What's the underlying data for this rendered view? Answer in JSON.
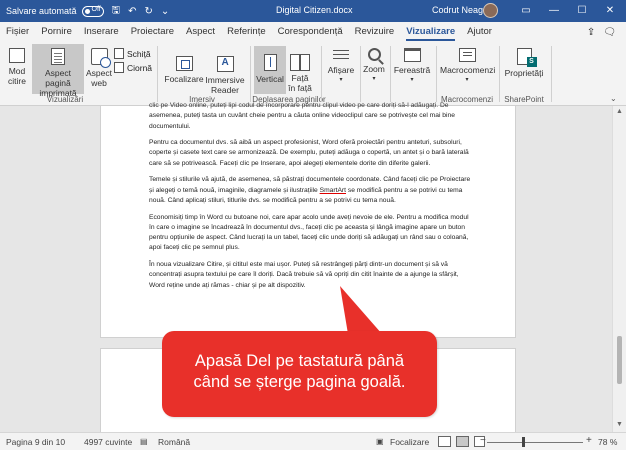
{
  "titlebar": {
    "autosave_label": "Salvare automată",
    "autosave_state": "Off",
    "document_title": "Digital Citizen.docx",
    "user_name": "Codrut Neagu",
    "accent_color": "#2b579a"
  },
  "tabs": [
    "Fișier",
    "Pornire",
    "Inserare",
    "Proiectare",
    "Aspect",
    "Referințe",
    "Corespondență",
    "Revizuire",
    "Vizualizare",
    "Ajutor"
  ],
  "active_tab": "Vizualizare",
  "ribbon": {
    "views": {
      "mod_citire": "Mod citire",
      "aspect_pagina": "Aspect pagină imprimată",
      "aspect_web": "Aspect web",
      "schita": "Schiță",
      "ciorna": "Ciornă",
      "group": "Vizualizări"
    },
    "immersive": {
      "focalizare": "Focalizare",
      "immersive_reader": "Immersive Reader",
      "group": "Imersiv"
    },
    "page_move": {
      "vertical": "Vertical",
      "side": "Față în față",
      "group": "Deplasarea paginilor"
    },
    "afisare": "Afișare",
    "zoom": "Zoom",
    "fereastra": "Fereastră",
    "macro": {
      "label": "Macrocomenzi",
      "group": "Macrocomenzi"
    },
    "sharepoint": {
      "label": "Proprietăți",
      "group": "SharePoint"
    }
  },
  "document": {
    "partial_line": "clic pe Video online, puteți lipi codul de încorporare pentru clipul video pe care doriți să-l adăugați. De",
    "paragraphs": [
      "asemenea, puteți tasta un cuvânt cheie pentru a căuta online videoclipul care se potrivește cel mai bine documentului.",
      "Pentru ca documentul dvs. să aibă un aspect profesionist, Word oferă proiectări pentru anteturi, subsoluri, coperte și casete text care se armonizează. De exemplu, puteți adăuga o copertă, un antet și o bară laterală care să se potrivească. Faceți clic pe Inserare, apoi alegeți elementele dorite din diferite galerii.",
      "Economisiți timp în Word cu butoane noi, care apar acolo unde aveți nevoie de ele. Pentru a modifica modul în care o imagine se încadrează în documentul dvs., faceți clic pe aceasta și lângă imagine apare un buton pentru opțiunile de aspect. Când lucrați la un tabel, faceți clic unde doriți să adăugați un rând sau o coloană, apoi faceți clic pe semnul plus.",
      "În noua vizualizare Citire, și cititul este mai ușor. Puteți să restrângeți părți dintr-un document și să vă concentrați asupra textului pe care îl doriți. Dacă trebuie să vă opriți din citit înainte de a ajunge la sfârșit, Word reține unde ați rămas - chiar și pe alt dispozitiv."
    ],
    "theme_paragraph": {
      "before": "Temele și stilurile vă ajută, de asemenea, să păstrați documentele coordonate. Când faceți clic pe Proiectare și alegeți o temă nouă, imaginile, diagramele și ilustrațiile ",
      "smartart": "SmartArt",
      "after": " se modifică pentru a se potrivi cu tema nouă. Când aplicați stiluri, titlurile dvs. se modifică pentru a se potrivi cu tema nouă."
    }
  },
  "callout": {
    "line1": "Apasă Del pe tastatură până",
    "line2": "când se șterge pagina goală.",
    "color": "#e8302a"
  },
  "statusbar": {
    "page": "Pagina 9 din 10",
    "words": "4997 cuvinte",
    "language": "Română",
    "focus": "Focalizare",
    "zoom_percent": "78 %",
    "zoom_value": 78
  }
}
